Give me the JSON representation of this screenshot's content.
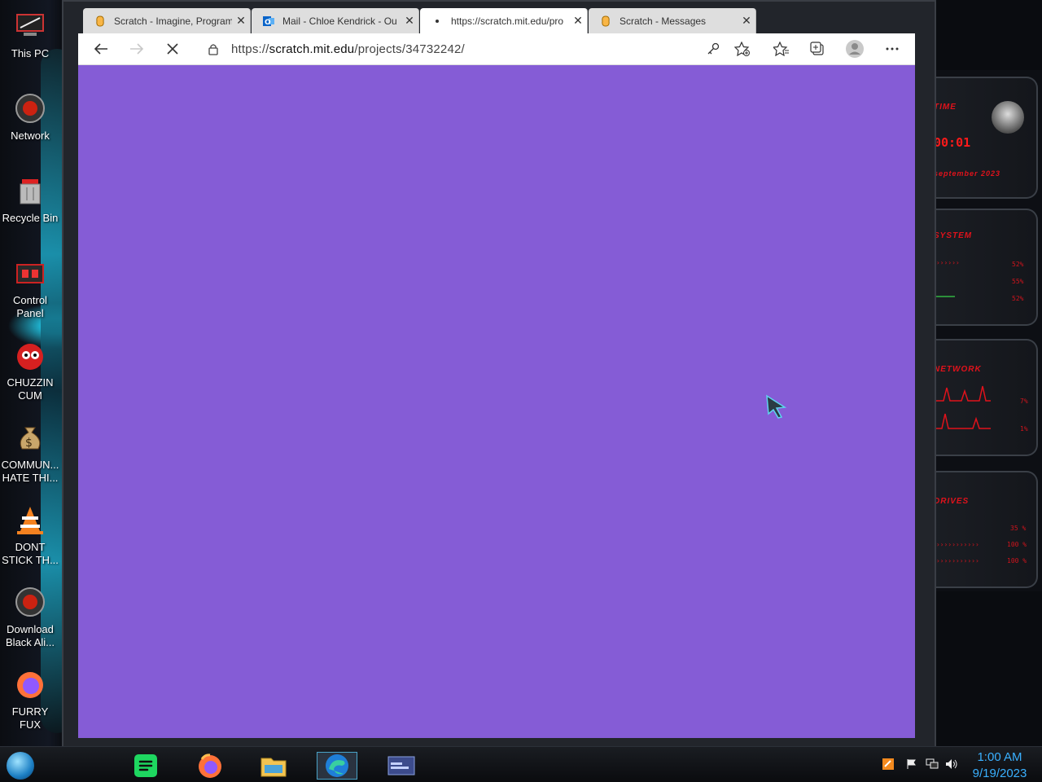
{
  "desktop": {
    "icons": [
      {
        "label": "This PC",
        "icon": "pc-icon"
      },
      {
        "label": "Network",
        "icon": "network-icon"
      },
      {
        "label": "Recycle Bin",
        "icon": "recycle-bin-icon"
      },
      {
        "label": "Control\nPanel",
        "icon": "control-panel-icon"
      },
      {
        "label": "CHUZZIN\nCUM",
        "icon": "chuzzle-icon"
      },
      {
        "label": "COMMUN...\nHATE THI...",
        "icon": "money-bag-icon"
      },
      {
        "label": "DONT\nSTICK TH...",
        "icon": "vlc-cone-icon"
      },
      {
        "label": "Download\nBlack Ali...",
        "icon": "alienware-icon"
      },
      {
        "label": "FURRY\nFUX",
        "icon": "firefox-icon"
      }
    ]
  },
  "browser": {
    "tabs": [
      {
        "title": "Scratch - Imagine, Program",
        "icon": "scratch-favicon",
        "active": false
      },
      {
        "title": "Mail - Chloe Kendrick - Ou",
        "icon": "outlook-favicon",
        "active": false
      },
      {
        "title": "https://scratch.mit.edu/pro",
        "icon": "loading-dot",
        "active": true
      },
      {
        "title": "Scratch - Messages",
        "icon": "scratch-favicon",
        "active": false
      }
    ],
    "close_glyph": "✕",
    "url": {
      "prefix": "https://",
      "host": "scratch.mit.edu",
      "path": "/projects/34732242/"
    },
    "page_background": "#855cd6"
  },
  "widget": {
    "time_title": "TIME",
    "time_value": "00:01",
    "date_value": "september 2023",
    "system_title": "SYSTEM",
    "system_values": [
      "52%",
      "55%",
      "52%"
    ],
    "network_title": "NETWORK",
    "network_values": [
      "7%",
      "1%"
    ],
    "drives_title": "DRIVES",
    "drive_values": [
      "35 %",
      "100 %",
      "100 %"
    ]
  },
  "taskbar": {
    "apps": [
      "spotify-icon",
      "firefox-icon",
      "file-explorer-icon",
      "edge-icon",
      "window-preview-icon"
    ],
    "time": "1:00 AM",
    "date": "9/19/2023"
  }
}
